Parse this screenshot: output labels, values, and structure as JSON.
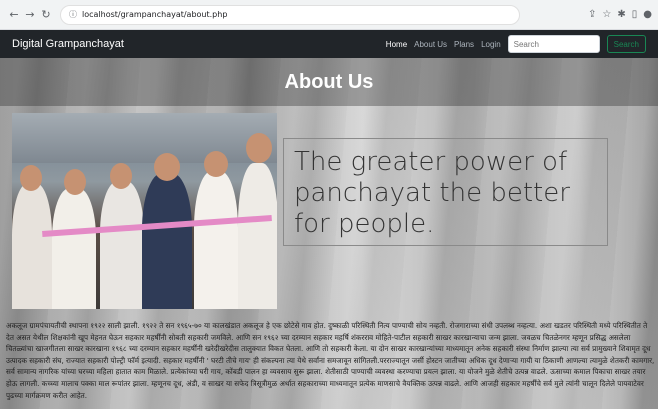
{
  "browser": {
    "url": "localhost/grampanchayat/about.php"
  },
  "navbar": {
    "brand": "Digital Grampanchayat",
    "links": [
      "Home",
      "About Us",
      "Plans",
      "Login"
    ],
    "search_placeholder": "Search",
    "search_button": "Search"
  },
  "main": {
    "title": "About Us",
    "tagline": "The greater power of panchayat the better for people.",
    "description": "अकलूज ग्रामपंचायतीची स्थापना १९२२ साली झाली. १९२२ ते सन १९६५-७० या कालखंडात अकलूज हे एक छोटेसे गाव होत. दुष्काळी परिस्थिती नित्य पाण्याची सोय नव्हती. रोजगाराच्या संधी उपलब्ध नव्हत्या. अशा खडतर परिस्थिती मध्ये परिस्थितीत ते देत असत येथील शिक्षकांनी खूप मेहनत घेऊन सहकार महर्षींनी सोबती सहकारी जमविले. आणि सन १९६२ च्या दरम्यान सहकार महर्षि शंकरराव मोहिते-पाटील सहकारी साखर कारखान्याचा जन्म झाला. जवळच चितळेनगर म्हणून प्रसिद्ध असलेला चितळ्यांचा खाजगीतला साखर कारखाना १९६८ च्या दरम्यान सहकार महर्षींनी खरेदीखरेदीस तालुक्यात विकत घेतला. आणि तो सहकारी केला. या दोन साखर कारखान्यांच्या माध्यमातून अनेक सहकारी संस्था निर्माण झाल्या त्या सर्व प्रामुख्याने शिवामृत दूध उत्पादक सहकारी संघ, राज्यात सहकारी पोल्ट्री फॉर्म इत्यादी. सहकार महर्षींनी ' घरटी तीचे गाय' ही संकल्पना त्या येथे सर्वांना समजावून सांगितली.परराज्यातून जर्सी होस्टन जातीच्या अधिक दूध देणाऱ्या गायी या ठिकाणी आणल्या त्यामुळे शेतकरी कामगार, सर्व सामान्य नागरिक यांच्या घरच्या महिला हातात काम मिळाले. प्रत्येकांच्या घरी गाय, कोंबडी पालन हा व्यवसाय सुरू झाला. शेतीसाठी पाण्याची व्यवस्था करण्याचा प्रयत्न झाला. या योजने मुळे शेतीचे उत्पन्न वाढले. ऊसाच्या कमाल पिकाचा साखर तयार होऊ लागली. कच्च्या मालाच पक्का माल रूपांतर झाला. म्हणूनच दूध, अंडी, व साखर या सफेद त्रिसूत्रीमुळ अर्थात सहकाराच्या माध्यमातून प्रत्येक माणसाचे वैयक्तिक उत्पन्न वाढले. आणि आजही सहकार महर्षींचे सर्व मुले त्यांनी चालून दिलेले पायवाटेवर पुढच्या मार्गक्रमण करीत आहेत."
  },
  "colors": {
    "navbar_bg": "#212529",
    "search_button": "#198754"
  }
}
